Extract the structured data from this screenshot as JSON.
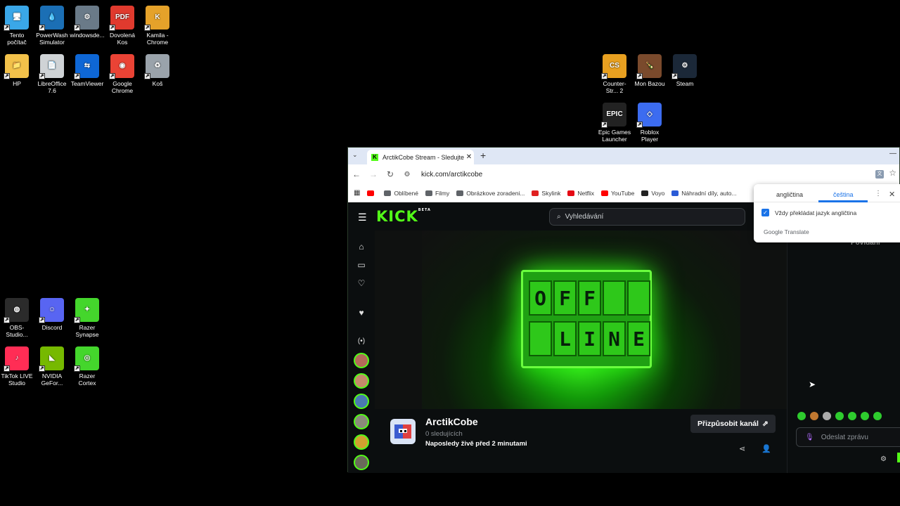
{
  "desktop": {
    "icons_left": [
      {
        "label": "Tento počítač",
        "color": "#3aa7e8",
        "glyph": "🖥"
      },
      {
        "label": "PowerWash Simulator",
        "color": "#1b6fb5",
        "glyph": "💧"
      },
      {
        "label": "windowsde...",
        "color": "#6a7a88",
        "glyph": "⚙"
      },
      {
        "label": "Dovolená Kos",
        "color": "#e03a2e",
        "glyph": "PDF"
      },
      {
        "label": "Kamila - Chrome",
        "color": "#e5a22a",
        "glyph": "K"
      },
      {
        "label": "HP",
        "color": "#f2c14a",
        "glyph": "📁"
      },
      {
        "label": "LibreOffice 7.6",
        "color": "#cfd3d6",
        "glyph": "📄"
      },
      {
        "label": "TeamViewer",
        "color": "#0e67d6",
        "glyph": "⇆"
      },
      {
        "label": "Google Chrome",
        "color": "#ea4335",
        "glyph": "◉"
      },
      {
        "label": "Koš",
        "color": "#9aa3ab",
        "glyph": "♻"
      }
    ],
    "icons_right": [
      {
        "label": "Counter-Str... 2",
        "color": "#e8a020",
        "glyph": "CS"
      },
      {
        "label": "Mon Bazou",
        "color": "#7a4a2c",
        "glyph": "🍾"
      },
      {
        "label": "Steam",
        "color": "#1b2838",
        "glyph": "⚙"
      },
      {
        "label": "Epic Games Launcher",
        "color": "#222222",
        "glyph": "EPIC"
      },
      {
        "label": "Roblox Player",
        "color": "#3c6cf0",
        "glyph": "◇"
      }
    ],
    "icons_bottom": [
      {
        "label": "OBS-Studio...",
        "color": "#2b2b2b",
        "glyph": "◍"
      },
      {
        "label": "Discord",
        "color": "#5865f2",
        "glyph": "☺"
      },
      {
        "label": "Razer Synapse",
        "color": "#44d62c",
        "glyph": "✦"
      },
      {
        "label": "TikTok LIVE Studio",
        "color": "#ff2d55",
        "glyph": "♪"
      },
      {
        "label": "NVIDIA GeFor...",
        "color": "#76b900",
        "glyph": "◣"
      },
      {
        "label": "Razer Cortex",
        "color": "#44d62c",
        "glyph": "◎"
      }
    ]
  },
  "browser": {
    "tab_title": "ArctikCobe Stream - Sledujte ži",
    "tab_close": "✕",
    "new_tab": "+",
    "url": "kick.com/arctikcobe",
    "bookmarks": [
      {
        "label": "",
        "color": "#ff0000"
      },
      {
        "label": "Oblíbené",
        "color": "#5f6368"
      },
      {
        "label": "Filmy",
        "color": "#5f6368"
      },
      {
        "label": "Obrázkove zoradeni...",
        "color": "#5f6368"
      },
      {
        "label": "Skylink",
        "color": "#e02020"
      },
      {
        "label": "Netflix",
        "color": "#e50914"
      },
      {
        "label": "YouTube",
        "color": "#ff0000"
      },
      {
        "label": "Voyo",
        "color": "#222222"
      },
      {
        "label": "Náhradní díly, auto...",
        "color": "#2a5bd7"
      }
    ]
  },
  "kick": {
    "logo": "KICK",
    "logo_badge": "BETA",
    "search_placeholder": "Vyhledávání",
    "offline_row1": [
      "O",
      "F",
      "F",
      "",
      ""
    ],
    "offline_row2": [
      "",
      "L",
      "I",
      "N",
      "E"
    ],
    "channel": {
      "name": "ArctikCobe",
      "followers": "0 sledujících",
      "last_live": "Naposledy živě před 2 minutami",
      "customize_button": "Přizpůsobit kanál"
    },
    "chat": {
      "caption": "Povídání",
      "input_placeholder": "Odeslat zprávu"
    }
  },
  "translate_popup": {
    "lang_source": "angličtina",
    "lang_target": "čeština",
    "always_translate": "Vždy překládat jazyk angličtina",
    "brand": "Google Translate"
  }
}
